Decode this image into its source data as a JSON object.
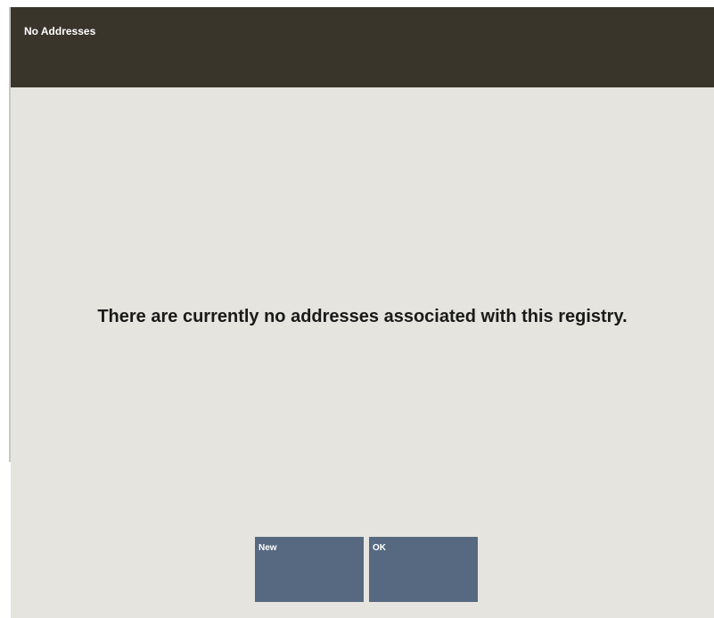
{
  "dialog": {
    "title": "No Addresses",
    "message": "There are currently no addresses associated with this registry."
  },
  "buttons": {
    "new_label": "New",
    "ok_label": "OK"
  },
  "colors": {
    "title_bar": "#3a352b",
    "background": "#e5e4df",
    "button": "#566980",
    "button_text": "#ffffff"
  }
}
